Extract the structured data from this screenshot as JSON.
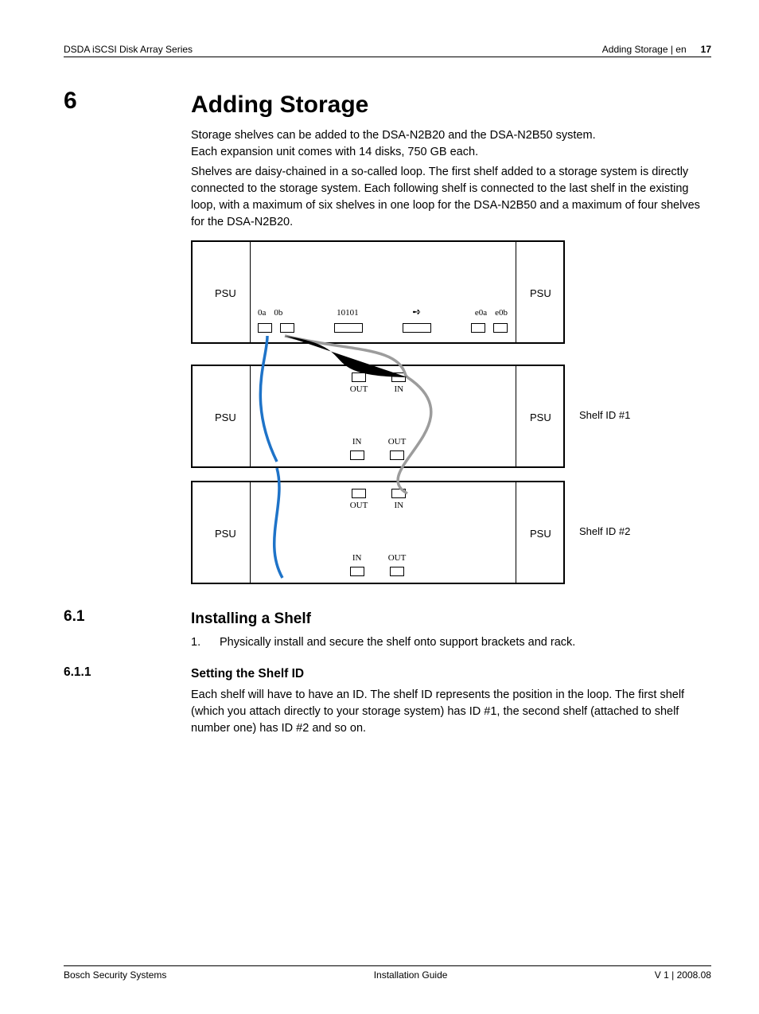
{
  "header": {
    "left": "DSDA iSCSI Disk Array Series",
    "right_text": "Adding Storage | en",
    "page_number": "17"
  },
  "section6": {
    "num": "6",
    "title": "Adding Storage",
    "p1": "Storage shelves can be added to the DSA-N2B20 and the DSA-N2B50 system.",
    "p2": "Each expansion unit comes with 14 disks, 750 GB each.",
    "p3": "Shelves are daisy-chained in a so-called loop. The first shelf added to a storage system is directly connected to the storage system. Each following shelf is connected to the last shelf in the existing loop, with a maximum of six shelves in one loop for the DSA-N2B50 and a maximum of four shelves for the DSA-N2B20."
  },
  "diagram": {
    "psu": "PSU",
    "shelf1": "Shelf ID #1",
    "shelf2": "Shelf ID #2",
    "ports_head": {
      "a": "0a",
      "b": "0b",
      "c": "10101",
      "d": "e0a",
      "e": "e0b"
    },
    "out": "OUT",
    "in": "IN"
  },
  "section61": {
    "num": "6.1",
    "title": "Installing a Shelf",
    "item_num": "1.",
    "item_text": "Physically install and secure the shelf onto support brackets and rack."
  },
  "section611": {
    "num": "6.1.1",
    "title": "Setting the Shelf ID",
    "p1": "Each shelf will have to have an ID. The shelf ID represents the position in the loop. The first shelf (which you attach directly to your storage system) has ID #1, the second shelf (attached to shelf number one) has ID #2 and so on."
  },
  "footer": {
    "left": "Bosch Security Systems",
    "center": "Installation Guide",
    "right": "V 1 | 2008.08"
  }
}
